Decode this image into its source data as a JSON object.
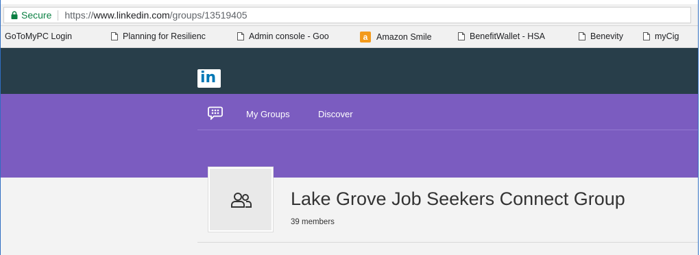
{
  "browser": {
    "secure_label": "Secure",
    "url_protocol": "https://",
    "url_host": "www.linkedin.com",
    "url_path": "/groups/13519405"
  },
  "bookmarks": [
    {
      "label": "GoToMyPC Login",
      "icon": "none"
    },
    {
      "label": "Planning for Resilienc",
      "icon": "page-icon"
    },
    {
      "label": "Admin console - Goo",
      "icon": "page-icon"
    },
    {
      "label": "Amazon Smile",
      "icon": "amazon-icon"
    },
    {
      "label": "BenefitWallet - HSA",
      "icon": "page-icon"
    },
    {
      "label": "Benevity",
      "icon": "page-icon"
    },
    {
      "label": "myCig",
      "icon": "page-icon"
    }
  ],
  "linkedin": {
    "logo_text": "in",
    "nav": {
      "my_groups": "My Groups",
      "discover": "Discover"
    },
    "group": {
      "title": "Lake Grove Job Seekers Connect Group",
      "members": "39 members"
    }
  },
  "colors": {
    "header": "#283e4a",
    "purple_band": "#7b5cc0",
    "secure_green": "#0b8043",
    "linkedin_blue": "#0077b5"
  }
}
